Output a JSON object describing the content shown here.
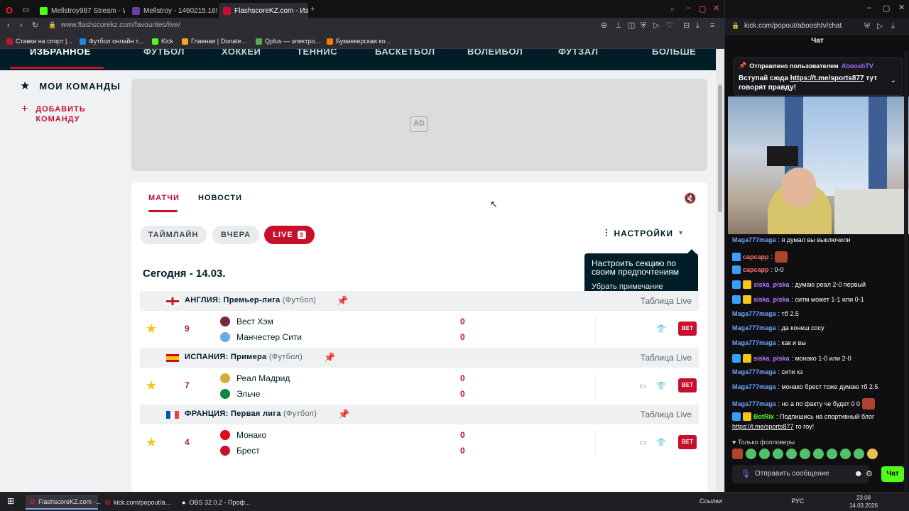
{
  "browser_left": {
    "tabs": [
      {
        "title": "Mellstroy987 Stream - Wa",
        "favicon_color": "#53fc18"
      },
      {
        "title": "Mellstroy - 1460215.16975",
        "favicon_color": "#6441a5"
      },
      {
        "title": "FlashscoreKZ.com - Избр",
        "favicon_color": "#c8102e"
      }
    ],
    "new_tab": "+",
    "url": "www.flashscorekz.com/favourites/live/",
    "bookmarks": [
      {
        "label": "Ставки на спорт |...",
        "color": "#c8102e"
      },
      {
        "label": "Футбол онлайн т...",
        "color": "#1e88e5"
      },
      {
        "label": "Kick",
        "color": "#53fc18"
      },
      {
        "label": "Главная | Donate...",
        "color": "#f5a623"
      },
      {
        "label": "Qplus — электро...",
        "color": "#4caf50"
      },
      {
        "label": "Букмекерская ко...",
        "color": "#f57c00"
      }
    ]
  },
  "site_nav": {
    "items": [
      "ИЗБРАННОЕ",
      "ФУТБОЛ",
      "ХОККЕЙ",
      "ТЕННИС",
      "БАСКЕТБОЛ",
      "ВОЛЕЙБОЛ",
      "ФУТЗАЛ",
      "БОЛЬШЕ"
    ]
  },
  "sidebar": {
    "my_teams": "МОИ КОМАНДЫ",
    "add_team_line1": "ДОБАВИТЬ",
    "add_team_line2": "КОМАНДУ"
  },
  "ad": {
    "label": "AD"
  },
  "panel": {
    "tabs": [
      "МАТЧИ",
      "НОВОСТИ"
    ],
    "filters": [
      "ТАЙМЛАЙН",
      "ВЧЕРА",
      "LIVE"
    ],
    "live_count": "3",
    "settings_label": "НАСТРОЙКИ",
    "tooltip_text": "Настроить секцию по своим предпочтениям",
    "tooltip_dismiss": "Убрать примечание",
    "date_label": "Сегодня - 14.03."
  },
  "leagues": [
    {
      "country": "АНГЛИЯ",
      "name": "Премьер-лига",
      "sport": "(Футбол)",
      "standing_link": "Таблица Live",
      "flag": "england",
      "match": {
        "minute": "9",
        "home": "Вест Хэм",
        "away": "Манчестер Сити",
        "home_score": "0",
        "away_score": "0",
        "home_color": "#7a263a",
        "away_color": "#6cabdd",
        "bet": "BET"
      }
    },
    {
      "country": "ИСПАНИЯ",
      "name": "Примера",
      "sport": "(Футбол)",
      "standing_link": "Таблица Live",
      "flag": "spain",
      "match": {
        "minute": "7",
        "home": "Реал Мадрид",
        "away": "Эльче",
        "home_score": "0",
        "away_score": "0",
        "home_color": "#d4af37",
        "away_color": "#0a8a3a",
        "bet": "BET"
      }
    },
    {
      "country": "ФРАНЦИЯ",
      "name": "Первая лига",
      "sport": "(Футбол)",
      "standing_link": "Таблица Live",
      "flag": "france",
      "match": {
        "minute": "4",
        "home": "Монако",
        "away": "Брест",
        "home_score": "0",
        "away_score": "0",
        "home_color": "#e30613",
        "away_color": "#c8102e",
        "bet": "BET"
      }
    }
  ],
  "chat_window": {
    "url": "kick.com/popout/abooshtv/chat",
    "title": "Чат",
    "pinned_header": "Отправлено пользователем",
    "pinned_user": "AbooshTV",
    "pinned_text_before": "Вступай сюда",
    "pinned_link": "https://t.me/sports877",
    "pinned_text_after": "тут говорят правду!",
    "messages": [
      {
        "user": "Maga777maga",
        "text": ": я думал вы выключили",
        "color": "#6ea3ff",
        "badges": 0
      },
      {
        "user": "capcapp",
        "text": ":",
        "color": "#ff6e6e",
        "badges": 1,
        "emote": true
      },
      {
        "user": "capcapp",
        "text": ": 0-0",
        "color": "#ff6e6e",
        "badges": 1
      },
      {
        "user": "siska_piska",
        "text": ": думаю реал 2-0 первый",
        "color": "#b97cff",
        "badges": 2
      },
      {
        "user": "siska_piska",
        "text": ": ситм может 1-1 или 0-1",
        "color": "#b97cff",
        "badges": 2
      },
      {
        "user": "Maga777maga",
        "text": ": тб 2.5",
        "color": "#6ea3ff",
        "badges": 0
      },
      {
        "user": "Maga777maga",
        "text": ": да конеш сосу",
        "color": "#6ea3ff",
        "badges": 0
      },
      {
        "user": "Maga777maga",
        "text": ": как и вы",
        "color": "#6ea3ff",
        "badges": 0
      },
      {
        "user": "siska_piska",
        "text": ": монако 1-0 или 2-0",
        "color": "#b97cff",
        "badges": 2
      },
      {
        "user": "Maga777maga",
        "text": ": сити хз",
        "color": "#6ea3ff",
        "badges": 0
      },
      {
        "user": "Maga777maga",
        "text": ": монако брест тоже думаю тб 2.5",
        "color": "#6ea3ff",
        "badges": 0
      },
      {
        "user": "Maga777maga",
        "text": ": но а по факту че будет 0 0",
        "color": "#6ea3ff",
        "badges": 0,
        "emote": true
      },
      {
        "user": "BotRix",
        "text": ": Подпишись на спортивный блог",
        "color": "#53fc18",
        "badges": 2
      }
    ],
    "bot_link": "https://t.me/sports877",
    "bot_after": "го гоу!",
    "followers_only": "Только фолловеры",
    "input_placeholder": "Отправить сообщение",
    "send_label": "Чат"
  },
  "taskbar": {
    "items": [
      "FlashscoreKZ.com -...",
      "kick.com/popout/a...",
      "OBS 32.0.2 - Проф..."
    ],
    "tray_links": "Ссылки",
    "lang": "РУС",
    "time": "23:08",
    "date": "14.03.2026"
  }
}
